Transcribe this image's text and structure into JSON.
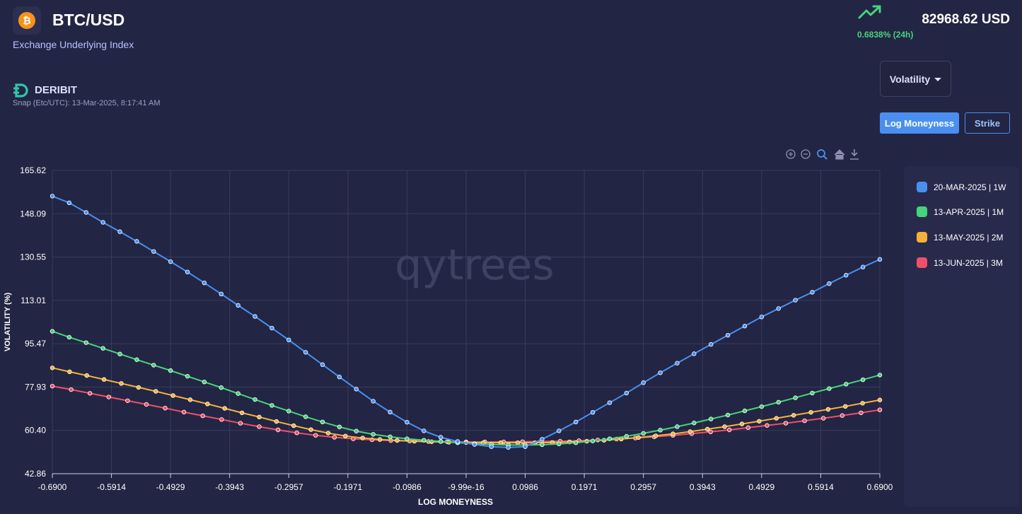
{
  "header": {
    "coin_glyph": "₿",
    "pair": "BTC/USD",
    "subtitle": "Exchange Underlying Index",
    "change": "0.6838% (24h)",
    "price": "82968.62 USD",
    "up_color": "#46d37b"
  },
  "exchange": {
    "name": "DERIBIT",
    "snap": "Snap (Etc/UTC): 13-Mar-2025, 8:17:41 AM"
  },
  "controls": {
    "metric_dropdown": "Volatility",
    "axis_options": [
      "Log Moneyness",
      "Strike"
    ],
    "selected_axis": "Log Moneyness"
  },
  "toolbar_icons": [
    "zoom-in-icon",
    "zoom-out-icon",
    "zoom-select-icon",
    "home-icon",
    "download-icon"
  ],
  "chart_data": {
    "type": "line",
    "xlabel": "LOG MONEYNESS",
    "ylabel": "VOLATILITY (%)",
    "xlim": [
      -0.69,
      0.69
    ],
    "ylim": [
      42.86,
      165.62
    ],
    "x_ticks": [
      "-0.6900",
      "-0.5914",
      "-0.4929",
      "-0.3943",
      "-0.2957",
      "-0.1971",
      "-0.0986",
      "-9.99e-16",
      "0.0986",
      "0.1971",
      "0.2957",
      "0.3943",
      "0.4929",
      "0.5914",
      "0.6900"
    ],
    "y_ticks": [
      "165.62",
      "148.09",
      "130.55",
      "113.01",
      "95.47",
      "77.93",
      "60.40",
      "42.86"
    ],
    "grid": true,
    "legend_position": "right",
    "watermark": "qytrees",
    "x": [
      -0.69,
      -0.6604,
      -0.6309,
      -0.6013,
      -0.5717,
      -0.5421,
      -0.5126,
      -0.483,
      -0.4534,
      -0.4239,
      -0.3943,
      -0.3647,
      -0.3351,
      -0.3056,
      -0.276,
      -0.2464,
      -0.2169,
      -0.1873,
      -0.1577,
      -0.1281,
      -0.0986,
      -0.069,
      -0.0394,
      -0.0099,
      0.0197,
      0.0493,
      0.0789,
      0.1084,
      0.138,
      0.1676,
      0.1971,
      0.2267,
      0.2563,
      0.2859,
      0.3154,
      0.345,
      0.3746,
      0.4041,
      0.4337,
      0.4633,
      0.4929,
      0.5224,
      0.552,
      0.5816,
      0.6111,
      0.6407,
      0.6703,
      0.69
    ],
    "series": [
      {
        "name": "20-MAR-2025 | 1W",
        "color": "#4a8ff0",
        "values": [
          155.2,
          152.5,
          148.6,
          144.6,
          140.8,
          136.9,
          132.8,
          128.7,
          124.5,
          120.1,
          115.6,
          111.0,
          106.5,
          101.8,
          97.0,
          92.0,
          87.0,
          82.0,
          77.1,
          72.2,
          67.8,
          63.7,
          60.2,
          57.6,
          55.9,
          54.7,
          53.8,
          53.5,
          53.8,
          56.8,
          60.2,
          63.8,
          67.7,
          71.6,
          75.5,
          79.7,
          83.7,
          87.6,
          91.4,
          95.2,
          98.9,
          102.6,
          106.3,
          109.7,
          113.1,
          116.3,
          119.8,
          123.2,
          126.5,
          129.6
        ]
      },
      {
        "name": "13-APR-2025 | 1M",
        "color": "#46d37b",
        "values": [
          100.5,
          98.1,
          95.9,
          93.6,
          91.3,
          89.0,
          86.8,
          84.6,
          82.3,
          80.0,
          77.7,
          75.3,
          72.9,
          70.5,
          68.2,
          65.9,
          63.8,
          61.8,
          60.1,
          58.8,
          57.8,
          57.0,
          56.4,
          55.9,
          55.4,
          55.0,
          54.7,
          54.5,
          54.5,
          54.6,
          54.9,
          55.4,
          56.1,
          57.0,
          58.0,
          59.2,
          60.5,
          61.9,
          63.4,
          65.0,
          66.6,
          68.3,
          70.0,
          71.8,
          73.6,
          75.5,
          77.3,
          79.1,
          80.9,
          82.8
        ]
      },
      {
        "name": "13-MAY-2025 | 2M",
        "color": "#f5b238",
        "values": [
          85.7,
          84.1,
          82.6,
          81.0,
          79.4,
          77.8,
          76.2,
          74.5,
          72.8,
          71.1,
          69.3,
          67.5,
          65.8,
          64.0,
          62.3,
          60.7,
          59.3,
          58.1,
          57.3,
          56.7,
          56.3,
          56.0,
          55.8,
          55.6,
          55.5,
          55.4,
          55.4,
          55.4,
          55.4,
          55.5,
          55.7,
          56.0,
          56.4,
          56.9,
          57.5,
          58.2,
          59.0,
          59.9,
          60.9,
          61.9,
          63.0,
          64.1,
          65.3,
          66.5,
          67.7,
          68.9,
          70.1,
          71.4,
          72.7
        ]
      },
      {
        "name": "13-JUN-2025 | 3M",
        "color": "#ef4f6a",
        "values": [
          78.3,
          76.9,
          75.4,
          73.9,
          72.4,
          70.9,
          69.4,
          67.8,
          66.3,
          64.8,
          63.3,
          61.9,
          60.6,
          59.4,
          58.4,
          57.6,
          57.0,
          56.6,
          56.3,
          56.1,
          55.9,
          55.8,
          55.7,
          55.7,
          55.7,
          55.8,
          55.9,
          56.0,
          56.2,
          56.5,
          56.9,
          57.3,
          57.8,
          58.4,
          59.1,
          59.8,
          60.6,
          61.5,
          62.4,
          63.3,
          64.3,
          65.3,
          66.4,
          67.5,
          68.7
        ]
      }
    ]
  }
}
